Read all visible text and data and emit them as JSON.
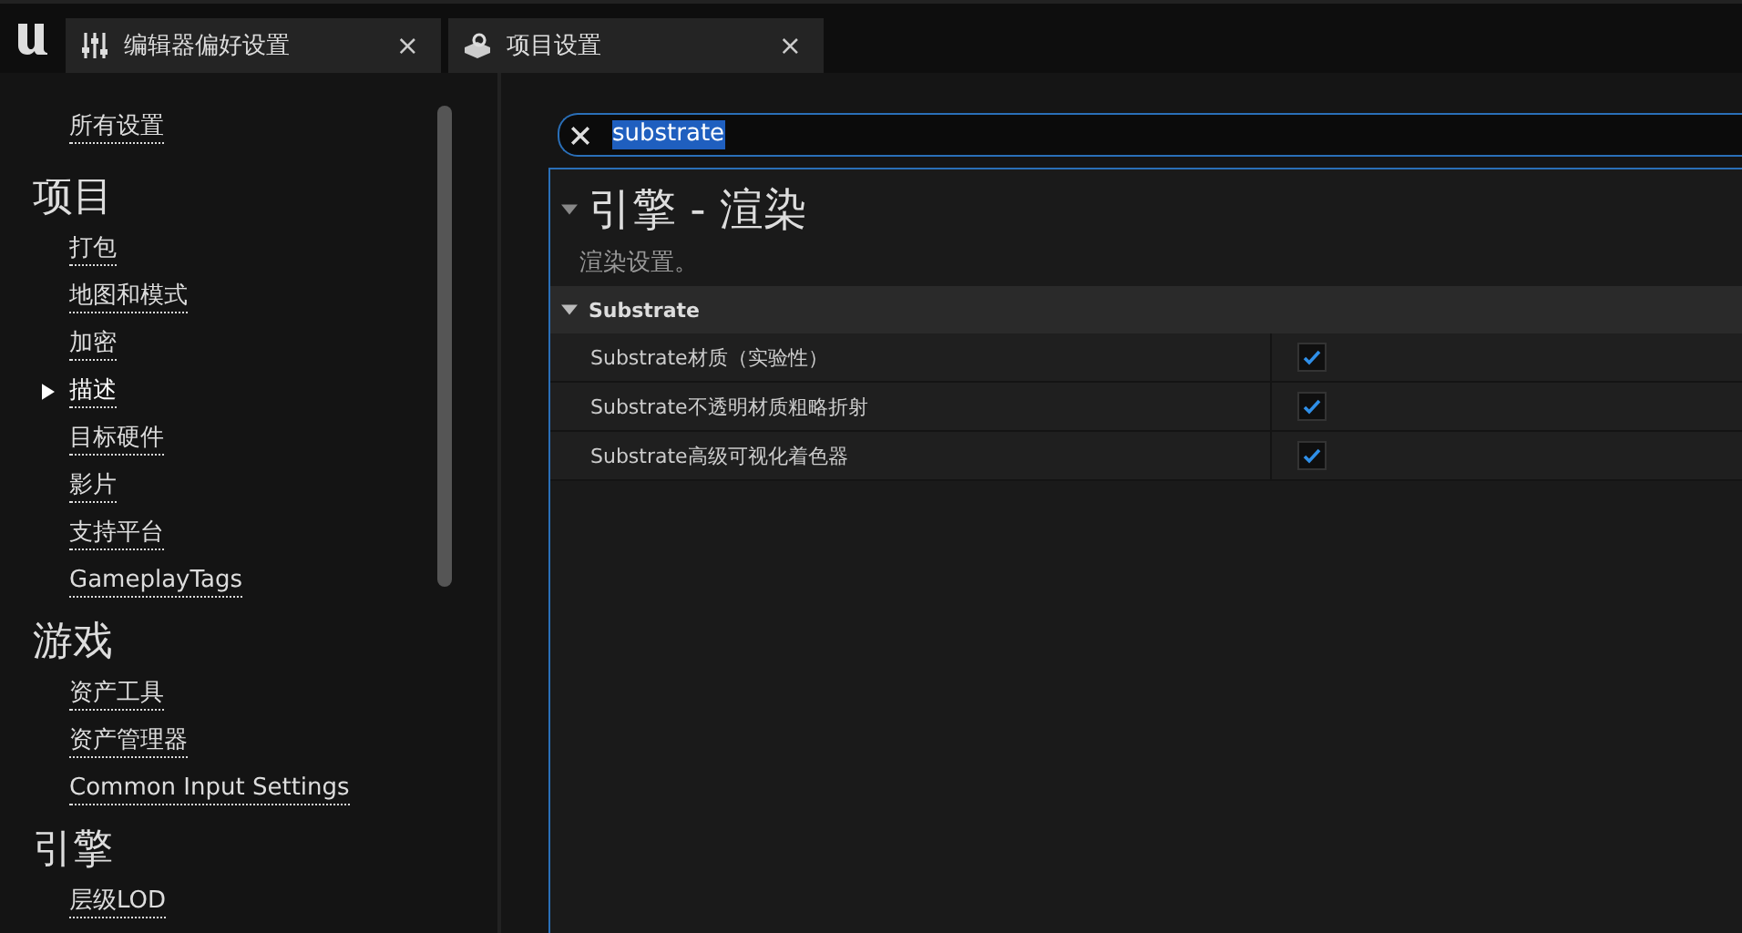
{
  "tabs": [
    {
      "label": "编辑器偏好设置",
      "kind": "sliders",
      "close": "×"
    },
    {
      "label": "项目设置",
      "kind": "project",
      "close": "×"
    }
  ],
  "sidebar": {
    "top_link": "所有设置",
    "sections": [
      {
        "title": "项目",
        "items": [
          {
            "label": "打包",
            "selected": false
          },
          {
            "label": "地图和模式",
            "selected": false
          },
          {
            "label": "加密",
            "selected": false
          },
          {
            "label": "描述",
            "selected": true
          },
          {
            "label": "目标硬件",
            "selected": false
          },
          {
            "label": "影片",
            "selected": false
          },
          {
            "label": "支持平台",
            "selected": false
          },
          {
            "label": "GameplayTags",
            "selected": false
          }
        ]
      },
      {
        "title": "游戏",
        "items": [
          {
            "label": "资产工具",
            "selected": false
          },
          {
            "label": "资产管理器",
            "selected": false
          },
          {
            "label": "Common Input Settings",
            "selected": false
          }
        ]
      },
      {
        "title": "引擎",
        "items": [
          {
            "label": "层级LOD",
            "selected": false
          }
        ]
      }
    ]
  },
  "search": {
    "value": "substrate"
  },
  "panel": {
    "title": "引擎 - 渲染",
    "description": "渲染设置。",
    "category": {
      "title": "Substrate",
      "expanded": true,
      "rows": [
        {
          "label": "Substrate材质（实验性）",
          "checked": true
        },
        {
          "label": "Substrate不透明材质粗略折射",
          "checked": true
        },
        {
          "label": "Substrate高级可视化着色器",
          "checked": true
        }
      ]
    }
  }
}
